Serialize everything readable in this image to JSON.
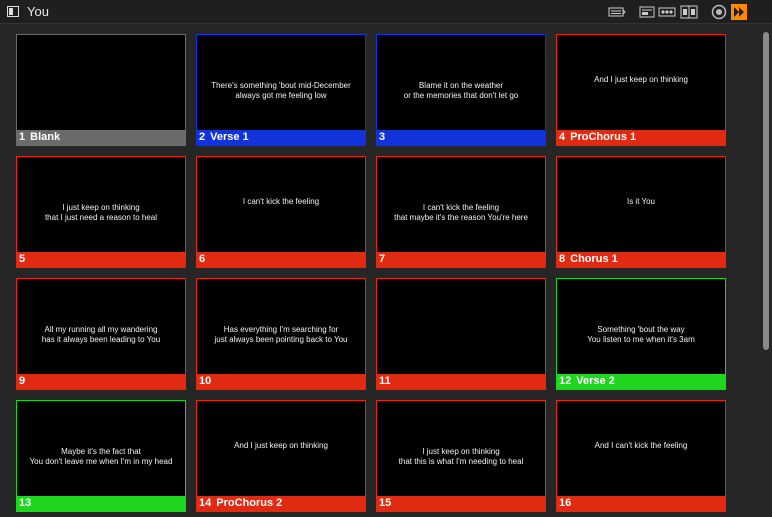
{
  "window": {
    "title": "You"
  },
  "toolbar": {
    "icons": [
      "keyboard-icon",
      "display-icon",
      "audio-icon",
      "split-icon",
      "record-icon",
      "play-next-icon"
    ],
    "accent": "#ff8a00"
  },
  "colors": {
    "gray": "#6a6a6a",
    "blue": "#1133d9",
    "red": "#e02a12",
    "green": "#1fd61f"
  },
  "slides": [
    {
      "number": "1",
      "group": "Blank",
      "color": "gray",
      "text": ""
    },
    {
      "number": "2",
      "group": "Verse 1",
      "color": "blue",
      "text": "There's something 'bout mid-December\nalways got me feeling low"
    },
    {
      "number": "3",
      "group": "",
      "color": "blue",
      "text": "Blame it on the weather\nor the memories that don't let go"
    },
    {
      "number": "4",
      "group": "ProChorus 1",
      "color": "red",
      "text": "And I just keep on thinking"
    },
    {
      "number": "5",
      "group": "",
      "color": "red",
      "text": "I just keep on thinking\nthat I just need a reason to heal"
    },
    {
      "number": "6",
      "group": "",
      "color": "red",
      "text": "I can't kick the feeling"
    },
    {
      "number": "7",
      "group": "",
      "color": "red",
      "text": "I can't kick the feeling\nthat maybe it's the reason You're here"
    },
    {
      "number": "8",
      "group": "Chorus 1",
      "color": "red",
      "text": "Is it You"
    },
    {
      "number": "9",
      "group": "",
      "color": "red",
      "text": "All my running all my wandering\nhas it always been leading to You"
    },
    {
      "number": "10",
      "group": "",
      "color": "red",
      "text": "Has everything I'm searching for\njust always been pointing back to You"
    },
    {
      "number": "11",
      "group": "",
      "color": "red",
      "text": ""
    },
    {
      "number": "12",
      "group": "Verse 2",
      "color": "green",
      "text": "Something 'bout the way\nYou listen to me when it's 3am"
    },
    {
      "number": "13",
      "group": "",
      "color": "green",
      "text": "Maybe it's the fact that\nYou don't leave me when I'm in my head"
    },
    {
      "number": "14",
      "group": "ProChorus 2",
      "color": "red",
      "text": "And I just keep on thinking"
    },
    {
      "number": "15",
      "group": "",
      "color": "red",
      "text": "I just keep on thinking\nthat this is what I'm needing to heal"
    },
    {
      "number": "16",
      "group": "",
      "color": "red",
      "text": "And I can't kick the feeling"
    }
  ]
}
